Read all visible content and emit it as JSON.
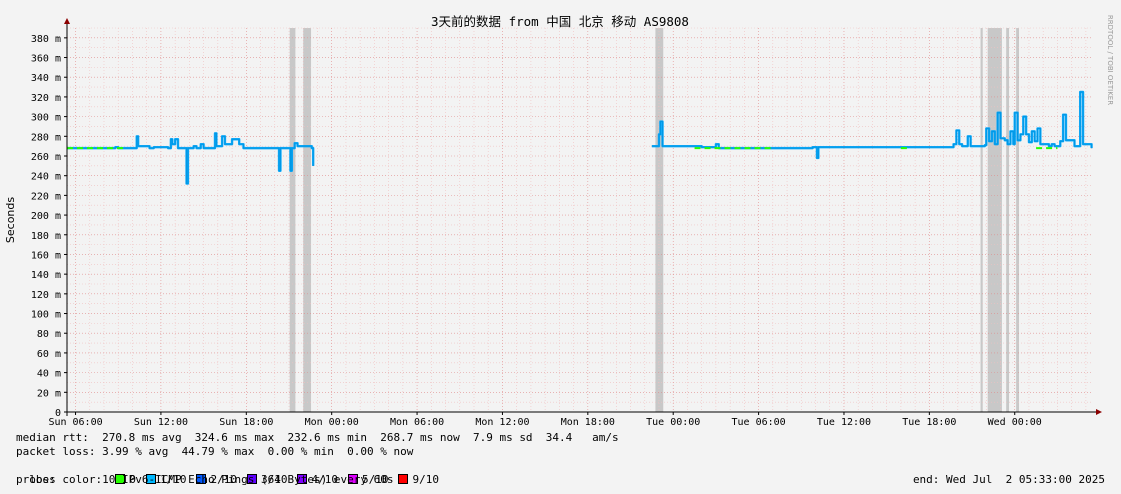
{
  "chart_data": {
    "type": "line",
    "title": "3天前的数据 from 中国 北京 移动 AS9808",
    "ylabel": "Seconds",
    "watermark": "RRDTOOL / TOBI OETIKER",
    "ylim": [
      0,
      0.39
    ],
    "y_ticks": [
      {
        "v": 0,
        "label": "0"
      },
      {
        "v": 0.02,
        "label": "20 m"
      },
      {
        "v": 0.04,
        "label": "40 m"
      },
      {
        "v": 0.06,
        "label": "60 m"
      },
      {
        "v": 0.08,
        "label": "80 m"
      },
      {
        "v": 0.1,
        "label": "100 m"
      },
      {
        "v": 0.12,
        "label": "120 m"
      },
      {
        "v": 0.14,
        "label": "140 m"
      },
      {
        "v": 0.16,
        "label": "160 m"
      },
      {
        "v": 0.18,
        "label": "180 m"
      },
      {
        "v": 0.2,
        "label": "200 m"
      },
      {
        "v": 0.22,
        "label": "220 m"
      },
      {
        "v": 0.24,
        "label": "240 m"
      },
      {
        "v": 0.26,
        "label": "260 m"
      },
      {
        "v": 0.28,
        "label": "280 m"
      },
      {
        "v": 0.3,
        "label": "300 m"
      },
      {
        "v": 0.32,
        "label": "320 m"
      },
      {
        "v": 0.34,
        "label": "340 m"
      },
      {
        "v": 0.36,
        "label": "360 m"
      },
      {
        "v": 0.38,
        "label": "380 m"
      }
    ],
    "x_ticks": [
      "Sun 06:00",
      "Sun 12:00",
      "Sun 18:00",
      "Mon 00:00",
      "Mon 06:00",
      "Mon 12:00",
      "Mon 18:00",
      "Tue 00:00",
      "Tue 06:00",
      "Tue 12:00",
      "Tue 18:00",
      "Wed 00:00"
    ],
    "xlim_hours": [
      -0.6,
      71.5
    ],
    "loss_bands_hours": [
      [
        15.05,
        15.45
      ],
      [
        16.0,
        16.55
      ],
      [
        40.75,
        41.3
      ],
      [
        63.6,
        63.75
      ],
      [
        64.1,
        65.1
      ],
      [
        65.4,
        65.6
      ],
      [
        66.1,
        66.3
      ]
    ],
    "series": [
      {
        "points": [
          [
            -0.6,
            0.268
          ],
          [
            2.0,
            0.268
          ],
          [
            2.8,
            0.269
          ],
          [
            3.0,
            0.268
          ],
          [
            4.2,
            0.268
          ],
          [
            4.3,
            0.28
          ],
          [
            4.4,
            0.27
          ],
          [
            5.2,
            0.268
          ],
          [
            5.5,
            0.269
          ],
          [
            6.5,
            0.268
          ],
          [
            6.7,
            0.277
          ],
          [
            6.8,
            0.272
          ],
          [
            7.0,
            0.277
          ],
          [
            7.2,
            0.268
          ],
          [
            7.7,
            0.268
          ],
          [
            7.8,
            0.232
          ],
          [
            7.9,
            0.268
          ],
          [
            8.3,
            0.27
          ],
          [
            8.5,
            0.268
          ],
          [
            8.8,
            0.272
          ],
          [
            9.0,
            0.268
          ],
          [
            9.7,
            0.268
          ],
          [
            9.8,
            0.283
          ],
          [
            9.9,
            0.27
          ],
          [
            10.3,
            0.28
          ],
          [
            10.5,
            0.272
          ],
          [
            11.0,
            0.277
          ],
          [
            11.3,
            0.277
          ],
          [
            11.5,
            0.272
          ],
          [
            11.8,
            0.268
          ],
          [
            13.5,
            0.268
          ],
          [
            14.2,
            0.268
          ],
          [
            14.3,
            0.245
          ],
          [
            14.4,
            0.268
          ],
          [
            15.0,
            0.268
          ],
          [
            15.1,
            0.245
          ],
          [
            15.2,
            0.268
          ],
          [
            15.4,
            0.273
          ],
          [
            15.6,
            0.27
          ],
          [
            16.6,
            0.268
          ],
          [
            16.7,
            0.25
          ]
        ],
        "color": "#00a8ff"
      },
      {
        "points": [
          [
            40.5,
            0.27
          ],
          [
            40.9,
            0.27
          ],
          [
            41.0,
            0.282
          ],
          [
            41.1,
            0.295
          ],
          [
            41.25,
            0.27
          ],
          [
            44.0,
            0.269
          ],
          [
            44.8,
            0.269
          ],
          [
            45.0,
            0.272
          ],
          [
            45.2,
            0.268
          ],
          [
            51.8,
            0.269
          ],
          [
            52.0,
            0.269
          ],
          [
            52.1,
            0.258
          ],
          [
            52.2,
            0.269
          ],
          [
            61.0,
            0.269
          ],
          [
            61.7,
            0.272
          ],
          [
            61.9,
            0.286
          ],
          [
            62.1,
            0.272
          ],
          [
            62.3,
            0.27
          ],
          [
            62.5,
            0.27
          ],
          [
            62.7,
            0.28
          ],
          [
            62.9,
            0.27
          ],
          [
            63.9,
            0.271
          ],
          [
            64.0,
            0.288
          ],
          [
            64.2,
            0.275
          ],
          [
            64.4,
            0.285
          ],
          [
            64.6,
            0.272
          ],
          [
            64.8,
            0.304
          ],
          [
            65.0,
            0.278
          ],
          [
            65.3,
            0.276
          ],
          [
            65.5,
            0.272
          ],
          [
            65.7,
            0.285
          ],
          [
            65.9,
            0.272
          ],
          [
            66.0,
            0.304
          ],
          [
            66.2,
            0.276
          ],
          [
            66.4,
            0.282
          ],
          [
            66.6,
            0.3
          ],
          [
            66.8,
            0.282
          ],
          [
            67.0,
            0.274
          ],
          [
            67.2,
            0.285
          ],
          [
            67.4,
            0.275
          ],
          [
            67.6,
            0.288
          ],
          [
            67.8,
            0.272
          ],
          [
            68.4,
            0.27
          ],
          [
            68.6,
            0.272
          ],
          [
            68.8,
            0.27
          ],
          [
            69.2,
            0.275
          ],
          [
            69.4,
            0.302
          ],
          [
            69.6,
            0.276
          ],
          [
            70.2,
            0.27
          ],
          [
            70.6,
            0.325
          ],
          [
            70.8,
            0.272
          ],
          [
            71.4,
            0.268
          ]
        ],
        "color": "#00a8ff"
      }
    ],
    "green_spans_hours": [
      [
        -0.6,
        3.5
      ],
      [
        43.5,
        49.0
      ],
      [
        58.0,
        58.5
      ],
      [
        67.5,
        69.0
      ]
    ]
  },
  "legend": {
    "median_rtt": "median rtt:  270.8 ms avg  324.6 ms max  232.6 ms min  268.7 ms now  7.9 ms sd  34.4   am/s",
    "packet_loss": "packet loss: 3.99 % avg  44.79 % max  0.00 % min  0.00 % now",
    "loss_color_label": "loss color:",
    "loss_colors": [
      {
        "label": "0",
        "color": "#26ff00"
      },
      {
        "label": "1/10",
        "color": "#00b8ff"
      },
      {
        "label": "2/10",
        "color": "#0059ff"
      },
      {
        "label": "3/10",
        "color": "#5e00ff"
      },
      {
        "label": "4/10",
        "color": "#7e00ff"
      },
      {
        "label": "5/10",
        "color": "#dd00ff"
      },
      {
        "label": "9/10",
        "color": "#ff0000"
      }
    ],
    "probe": "probe:       10 IPv6-ICMP Echo Pings (64 Bytes) every 60s",
    "end": "end: Wed Jul  2 05:33:00 2025"
  }
}
